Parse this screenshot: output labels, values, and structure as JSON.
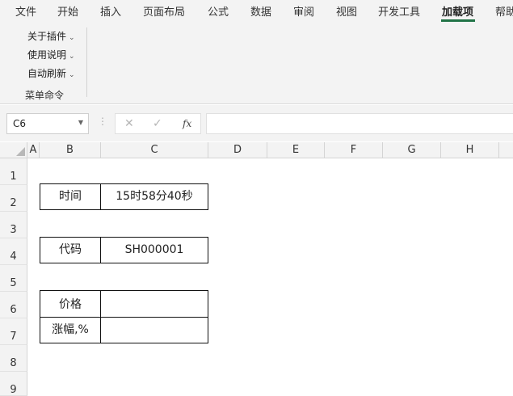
{
  "ribbon_tabs": [
    {
      "label": "文件"
    },
    {
      "label": "开始"
    },
    {
      "label": "插入"
    },
    {
      "label": "页面布局"
    },
    {
      "label": "公式"
    },
    {
      "label": "数据"
    },
    {
      "label": "审阅"
    },
    {
      "label": "视图"
    },
    {
      "label": "开发工具"
    },
    {
      "label": "加载项",
      "active": true
    },
    {
      "label": "帮助"
    }
  ],
  "ribbon": {
    "commands": [
      {
        "label": "关于插件"
      },
      {
        "label": "使用说明"
      },
      {
        "label": "自动刷新"
      }
    ],
    "group_label": "菜单命令"
  },
  "formula_bar": {
    "name_box": "C6",
    "fx_label": "fx",
    "formula": ""
  },
  "grid": {
    "columns": [
      "A",
      "B",
      "C",
      "D",
      "E",
      "F",
      "G",
      "H"
    ],
    "rows": [
      "1",
      "2",
      "3",
      "4",
      "5",
      "6",
      "7",
      "8",
      "9"
    ]
  },
  "sheet": {
    "time_label": "时间",
    "time_value": "15时58分40秒",
    "code_label": "代码",
    "code_value": "SH000001",
    "price_label": "价格",
    "price_value": "",
    "change_label": "涨幅,%",
    "change_value": ""
  },
  "colors": {
    "accent": "#217346",
    "ribbon_bg": "#f3f3f3"
  }
}
